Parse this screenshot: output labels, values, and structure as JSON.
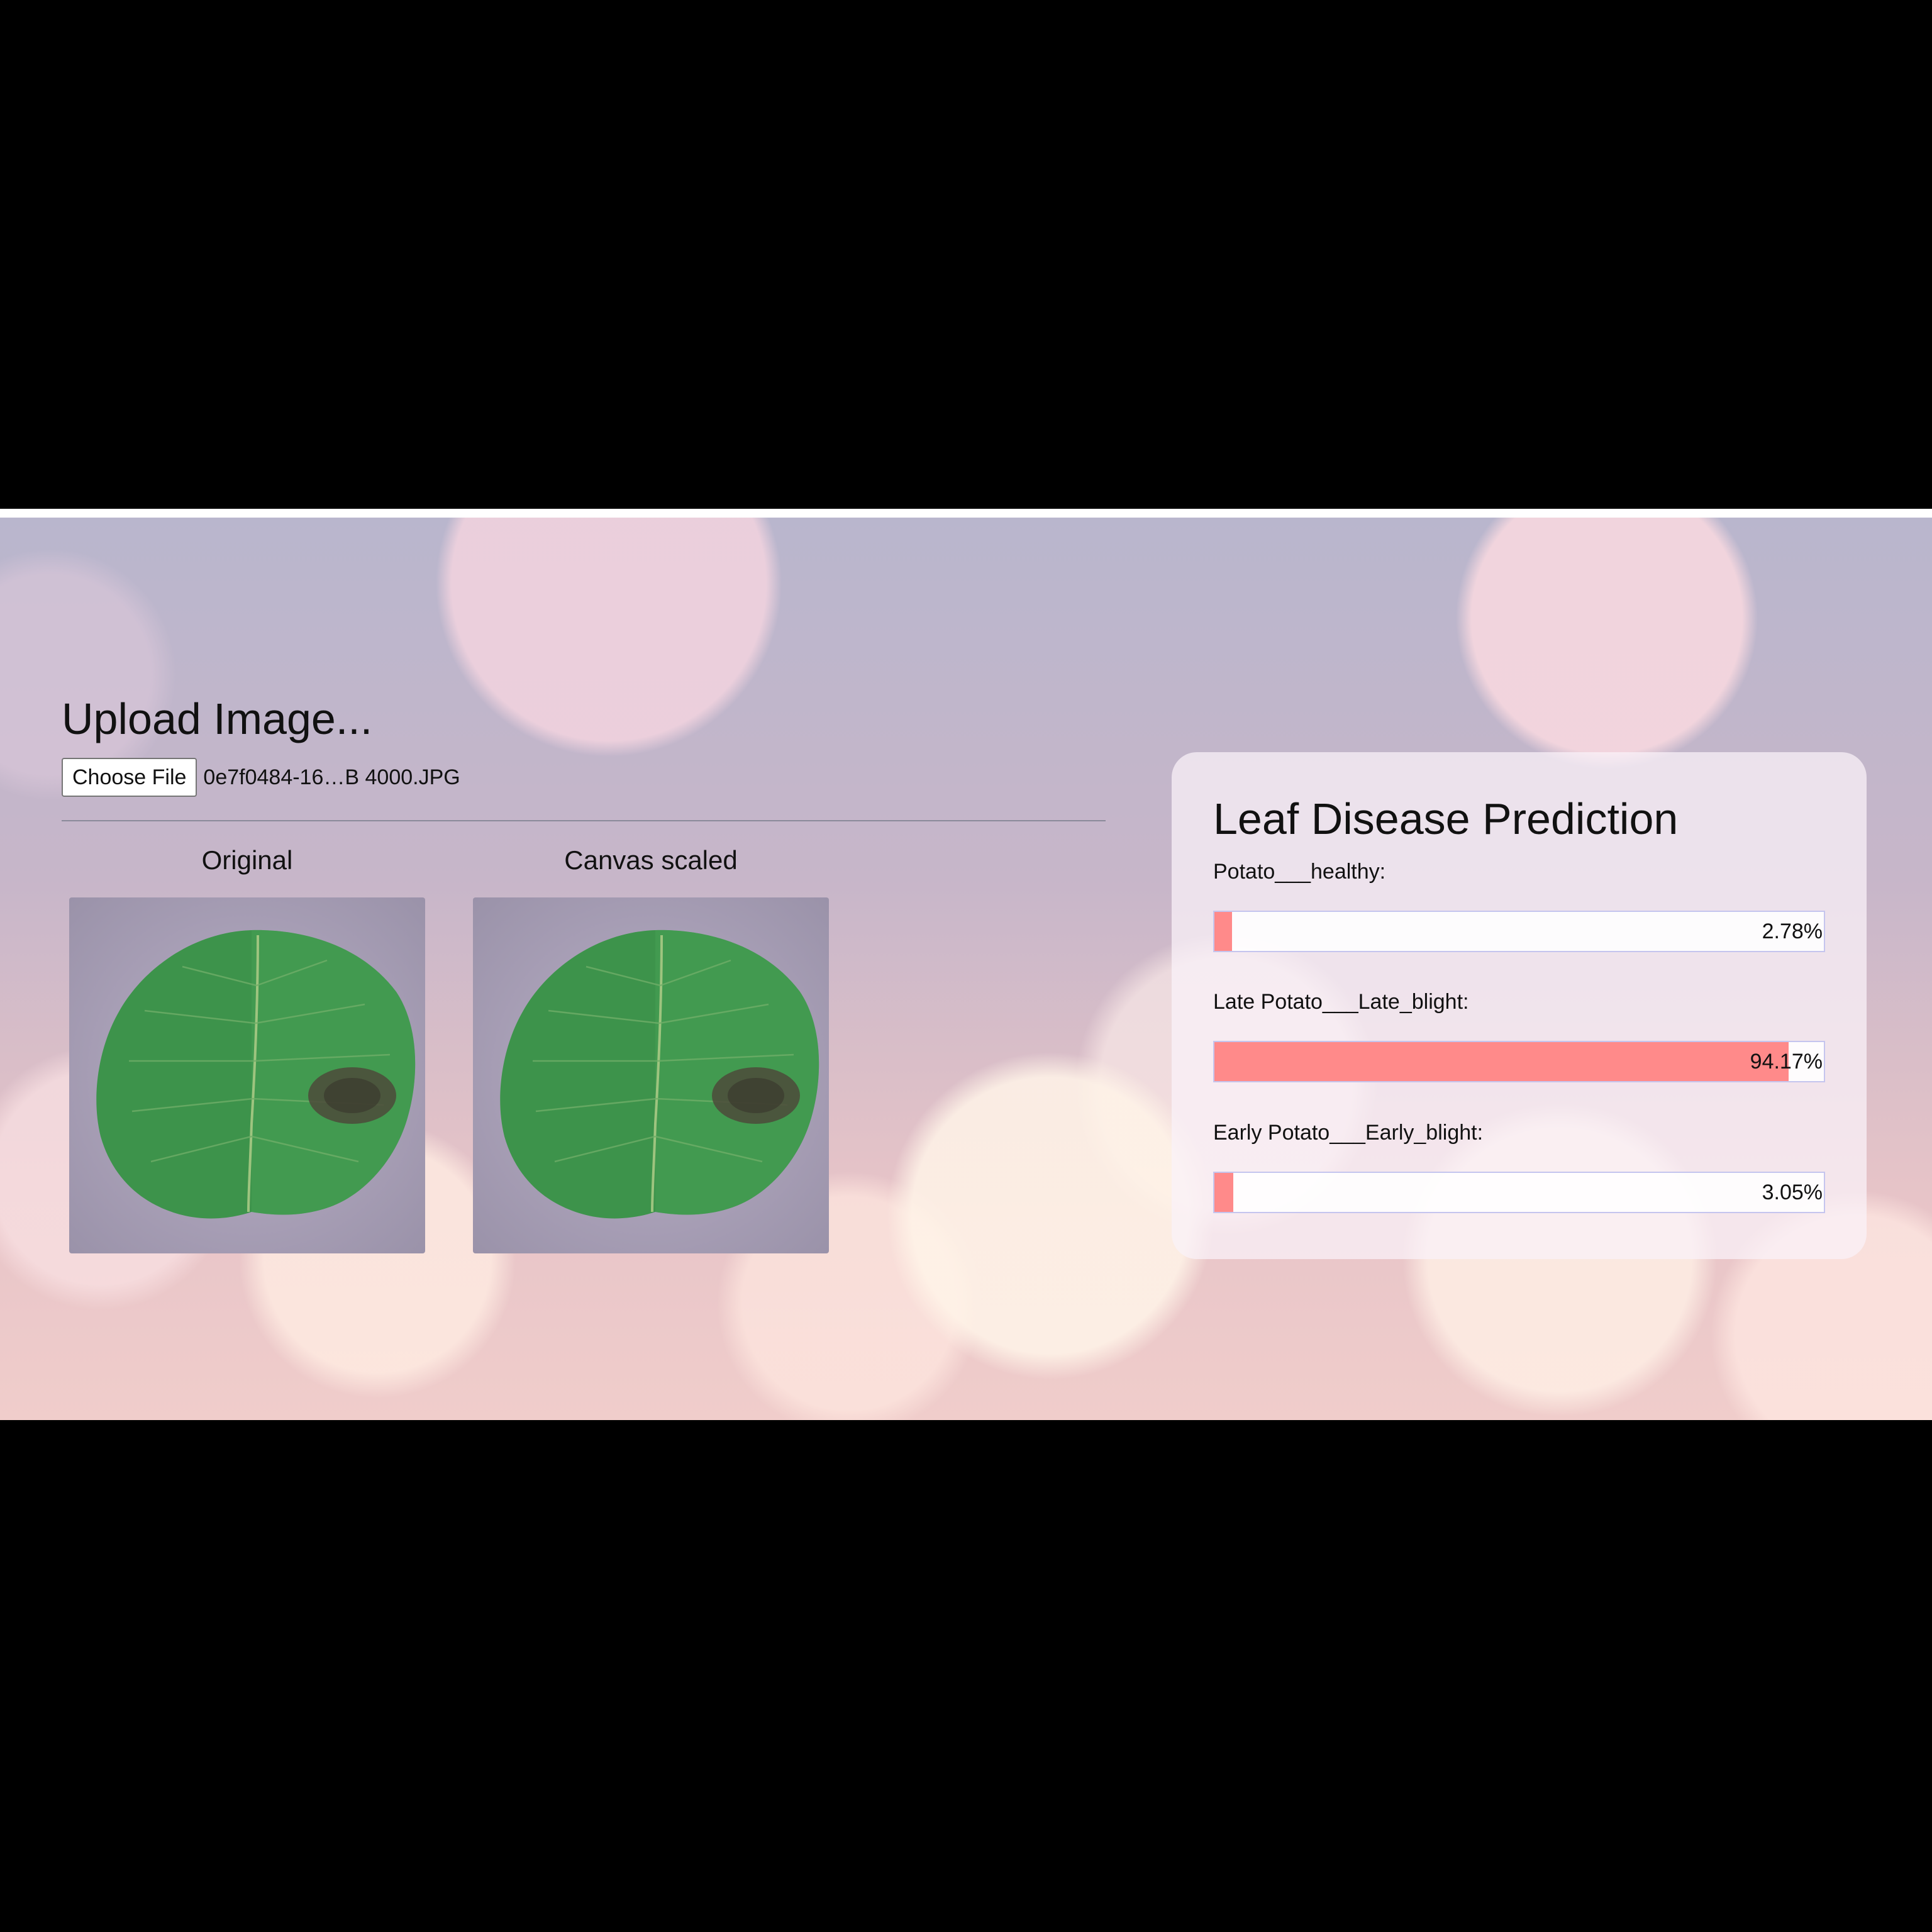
{
  "upload": {
    "title": "Upload Image...",
    "choose_button": "Choose File",
    "file_name": "0e7f0484-16…B 4000.JPG"
  },
  "images": {
    "original_caption": "Original",
    "scaled_caption": "Canvas scaled"
  },
  "prediction": {
    "title": "Leaf Disease Prediction",
    "items": [
      {
        "label": "Potato___healthy:",
        "percent_text": "2.78%",
        "value": 2.78
      },
      {
        "label": "Late Potato___Late_blight:",
        "percent_text": "94.17%",
        "value": 94.17
      },
      {
        "label": "Early Potato___Early_blight:",
        "percent_text": "3.05%",
        "value": 3.05
      }
    ]
  },
  "colors": {
    "bar_fill": "#ff8a8a",
    "bar_border": "#c5c5ee",
    "leaf_green": "#3f9a4e",
    "leaf_spot": "#4c4a3a"
  }
}
